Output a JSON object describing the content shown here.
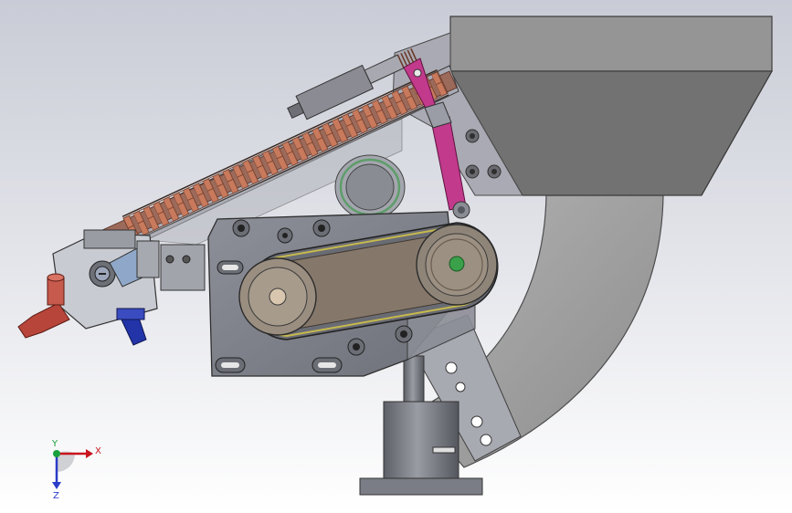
{
  "viewport": {
    "background_top": "#c9ccd6",
    "background_bottom": "#ffffff"
  },
  "triad": {
    "x_label": "X",
    "y_label": "Y",
    "z_label": "Z",
    "x_color": "#c8141e",
    "y_color": "#19a03c",
    "z_color": "#2a3cc8"
  },
  "colors": {
    "hopper": "#8f8f8f",
    "frame": "#7d7f88",
    "belt": "#c6b94d",
    "copper": "#b86a52",
    "link_magenta": "#c23a8c",
    "fitting_red": "#b8453a",
    "knob_blue": "#2234a8"
  }
}
